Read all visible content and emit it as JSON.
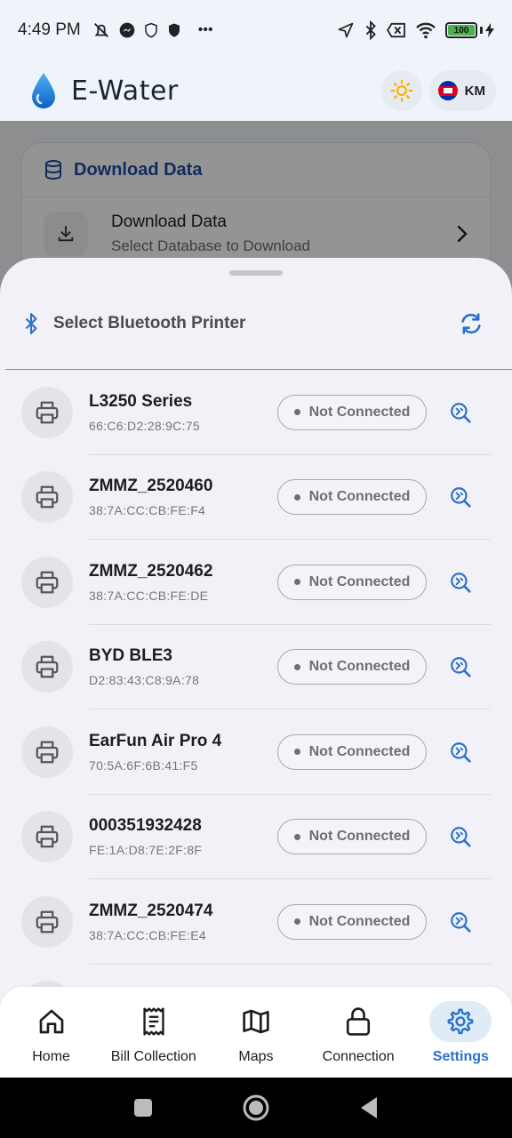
{
  "status_bar": {
    "time": "4:49 PM",
    "more": "•••",
    "battery_level": "100"
  },
  "header": {
    "app_title": "E-Water",
    "language_code": "KM"
  },
  "background": {
    "card_title": "Download Data",
    "row_title": "Download Data",
    "row_subtitle": "Select Database to Download"
  },
  "sheet": {
    "title": "Select Bluetooth Printer",
    "devices": [
      {
        "name": "L3250 Series",
        "mac": "66:C6:D2:28:9C:75",
        "status": "Not Connected"
      },
      {
        "name": "ZMMZ_2520460",
        "mac": "38:7A:CC:CB:FE:F4",
        "status": "Not Connected"
      },
      {
        "name": "ZMMZ_2520462",
        "mac": "38:7A:CC:CB:FE:DE",
        "status": "Not Connected"
      },
      {
        "name": "BYD BLE3",
        "mac": "D2:83:43:C8:9A:78",
        "status": "Not Connected"
      },
      {
        "name": "EarFun Air Pro 4",
        "mac": "70:5A:6F:6B:41:F5",
        "status": "Not Connected"
      },
      {
        "name": "000351932428",
        "mac": "FE:1A:D8:7E:2F:8F",
        "status": "Not Connected"
      },
      {
        "name": "ZMMZ_2520474",
        "mac": "38:7A:CC:CB:FE:E4",
        "status": "Not Connected"
      }
    ]
  },
  "bottom_nav": {
    "items": [
      {
        "label": "Home",
        "icon": "home-icon"
      },
      {
        "label": "Bill Collection",
        "icon": "receipt-icon"
      },
      {
        "label": "Maps",
        "icon": "map-icon"
      },
      {
        "label": "Connection",
        "icon": "lock-icon"
      },
      {
        "label": "Settings",
        "icon": "gear-icon",
        "active": true
      }
    ]
  },
  "colors": {
    "accent": "#2a72c9",
    "header_bg": "#eef4fa",
    "sheet_bg": "#f2f1f7",
    "sun": "#f5b400"
  }
}
